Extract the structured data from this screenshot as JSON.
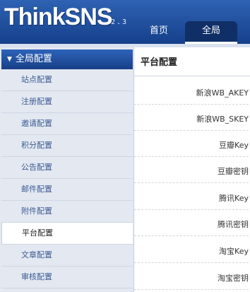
{
  "header": {
    "logo": "ThinkSNS",
    "version": "2.3",
    "nav": [
      {
        "label": "首页",
        "active": false
      },
      {
        "label": "全局",
        "active": true
      }
    ]
  },
  "sidebar": {
    "section_title": "全局配置",
    "items": [
      {
        "label": "站点配置"
      },
      {
        "label": "注册配置"
      },
      {
        "label": "邀请配置"
      },
      {
        "label": "积分配置"
      },
      {
        "label": "公告配置"
      },
      {
        "label": "邮件配置"
      },
      {
        "label": "附件配置"
      },
      {
        "label": "平台配置",
        "active": true
      },
      {
        "label": "文章配置"
      },
      {
        "label": "审核配置"
      }
    ]
  },
  "main": {
    "title": "平台配置",
    "fields": [
      {
        "label": "新浪WB_AKEY"
      },
      {
        "label": "新浪WB_SKEY"
      },
      {
        "label": "豆瓣Key"
      },
      {
        "label": "豆瓣密钥"
      },
      {
        "label": "腾讯Key"
      },
      {
        "label": "腾讯密钥"
      },
      {
        "label": "淘宝Key"
      },
      {
        "label": "淘宝密钥"
      }
    ]
  },
  "colors": {
    "header_blue": "#1f4c9c",
    "sidebar_bg": "#e3e8f1",
    "link_blue": "#3c5a93"
  }
}
